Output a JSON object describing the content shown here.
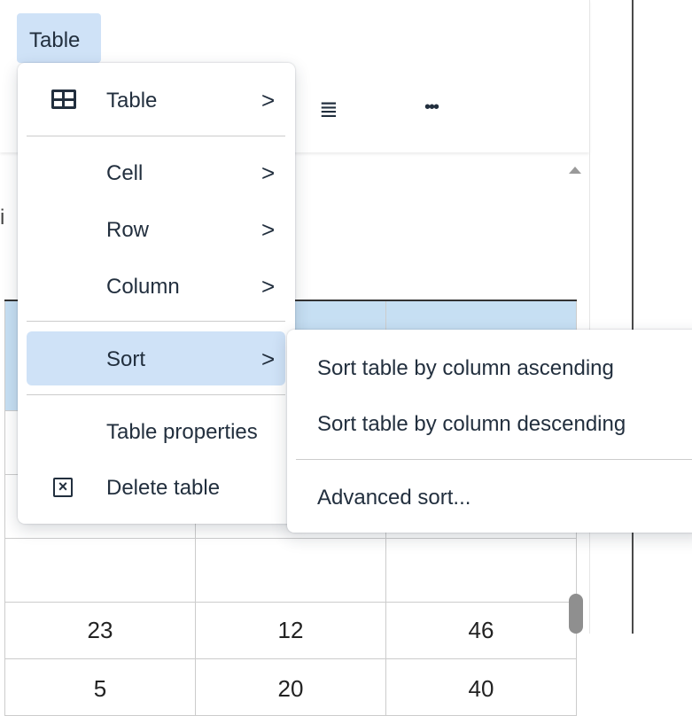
{
  "menubar": {
    "table_label": "Table"
  },
  "toolbar": {
    "align_icon": "≣",
    "more_icon": "•••"
  },
  "stray_text": "i",
  "table": {
    "rows": [
      [
        "",
        "",
        ""
      ],
      [
        "",
        "",
        ""
      ],
      [
        "",
        "",
        ""
      ],
      [
        "",
        "",
        ""
      ],
      [
        "23",
        "12",
        "46"
      ],
      [
        "5",
        "20",
        "40"
      ]
    ]
  },
  "main_menu": {
    "items": [
      {
        "label": "Table",
        "chevron": ">",
        "icon": "table-grid-icon"
      },
      {
        "label": "Cell",
        "chevron": ">"
      },
      {
        "label": "Row",
        "chevron": ">"
      },
      {
        "label": "Column",
        "chevron": ">"
      },
      {
        "label": "Sort",
        "chevron": ">",
        "active": true
      },
      {
        "label": "Table properties"
      },
      {
        "label": "Delete table",
        "icon": "delete-table-icon"
      }
    ]
  },
  "sort_submenu": {
    "items": [
      {
        "label": "Sort table by column ascending"
      },
      {
        "label": "Sort table by column descending"
      },
      {
        "label": "Advanced sort..."
      }
    ]
  },
  "colors": {
    "highlight": "#cfe2f7",
    "header_fill": "#c6dff3",
    "text": "#222f3e"
  }
}
